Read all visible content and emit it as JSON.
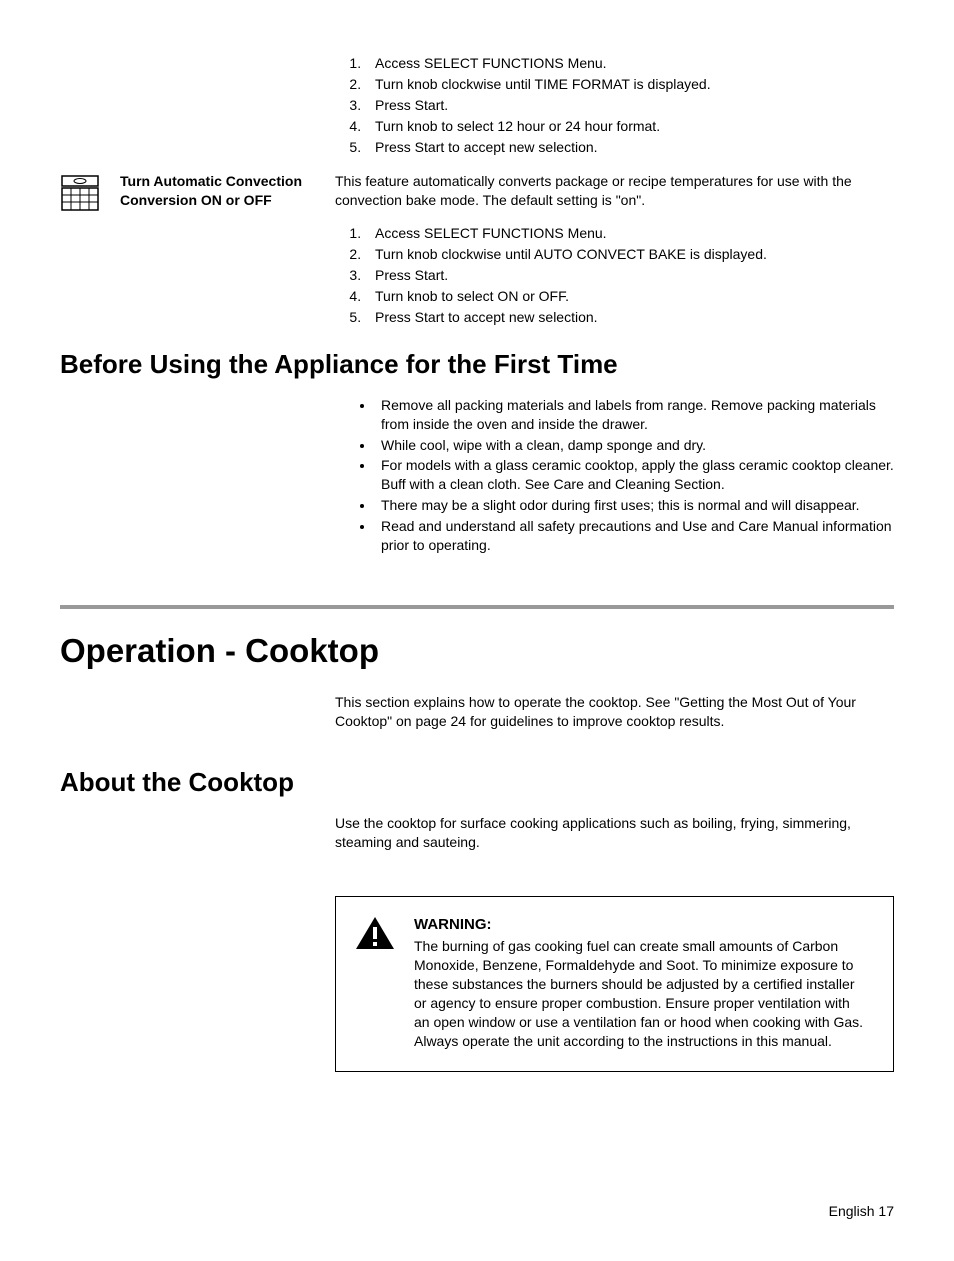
{
  "intro_steps": [
    "Access SELECT FUNCTIONS Menu.",
    "Turn knob clockwise until TIME FORMAT is displayed.",
    "Press Start.",
    "Turn knob to select 12 hour or 24 hour format.",
    "Press Start to accept new selection."
  ],
  "convect": {
    "label": "Turn Automatic Convection Conversion ON or OFF",
    "desc": "This feature automatically converts package or recipe temperatures for use with the convection bake mode. The default setting is \"on\".",
    "steps": [
      "Access SELECT FUNCTIONS Menu.",
      "Turn knob clockwise until AUTO CONVECT BAKE is displayed.",
      "Press Start.",
      "Turn knob to select ON or OFF.",
      "Press Start to accept new selection."
    ]
  },
  "before_use": {
    "heading": "Before Using the Appliance for the First Time",
    "bullets": [
      "Remove all packing materials and labels from range. Remove packing materials from inside the oven and inside the drawer.",
      "While cool, wipe with a clean, damp sponge and dry.",
      "For models with a glass ceramic cooktop, apply the glass ceramic cooktop cleaner. Buff with a clean cloth. See Care and Cleaning Section.",
      "There may be a slight odor during first uses; this is normal and will disappear.",
      "Read and understand all safety precautions and Use and Care Manual information prior to operating."
    ]
  },
  "operation": {
    "heading": "Operation - Cooktop",
    "intro": "This section explains how to operate the cooktop. See \"Getting the Most Out of Your Cooktop\" on page 24 for guidelines to improve cooktop results."
  },
  "about": {
    "heading": "About the Cooktop",
    "body": "Use the cooktop for surface cooking applications such as boiling, frying, simmering, steaming and sauteing."
  },
  "warning": {
    "label": "WARNING:",
    "body": "The burning of gas cooking fuel can create small amounts of Carbon Monoxide, Benzene, Formaldehyde and Soot. To minimize exposure to these substances the burners should be adjusted by a certified installer or agency to ensure proper combustion. Ensure proper ventilation with an open window or use a ventilation fan or hood when cooking with Gas. Always operate the unit according to the instructions in this manual."
  },
  "footer": "English 17"
}
